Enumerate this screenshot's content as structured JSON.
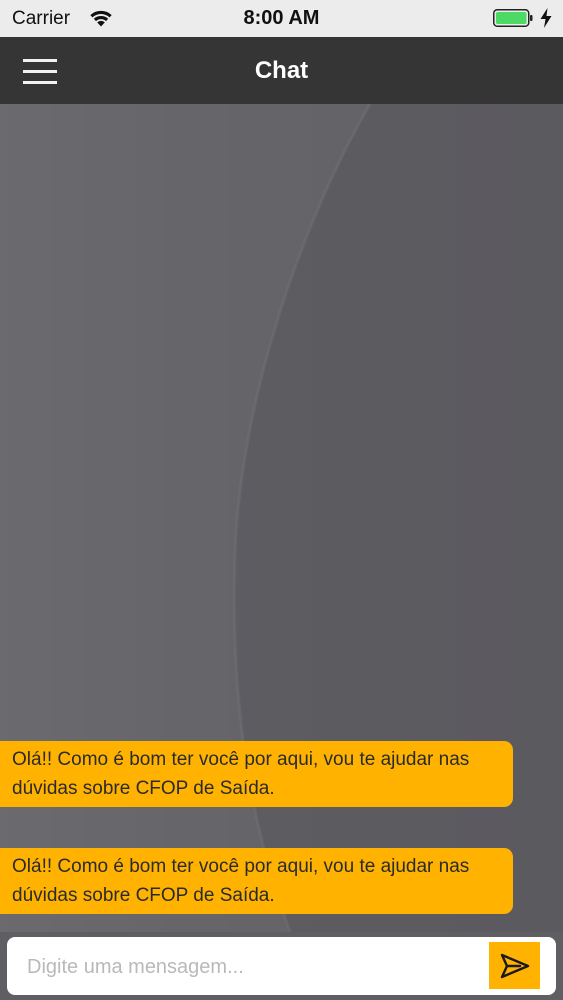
{
  "status_bar": {
    "carrier": "Carrier",
    "time": "8:00 AM",
    "battery_color": "#4cd964"
  },
  "nav": {
    "title": "Chat",
    "menu_icon": "hamburger-icon"
  },
  "messages": [
    {
      "text": "Olá!! Como é bom ter você por aqui, vou te ajudar nas dúvidas sobre CFOP de Saída."
    },
    {
      "text": "Olá!! Como é bom ter você por aqui, vou te ajudar nas dúvidas sobre CFOP de Saída."
    }
  ],
  "composer": {
    "placeholder": "Digite uma mensagem...",
    "value": "",
    "send_icon": "send-icon"
  },
  "colors": {
    "accent": "#ffb300",
    "nav_background": "#353535",
    "chat_background": "#5f5e63"
  }
}
